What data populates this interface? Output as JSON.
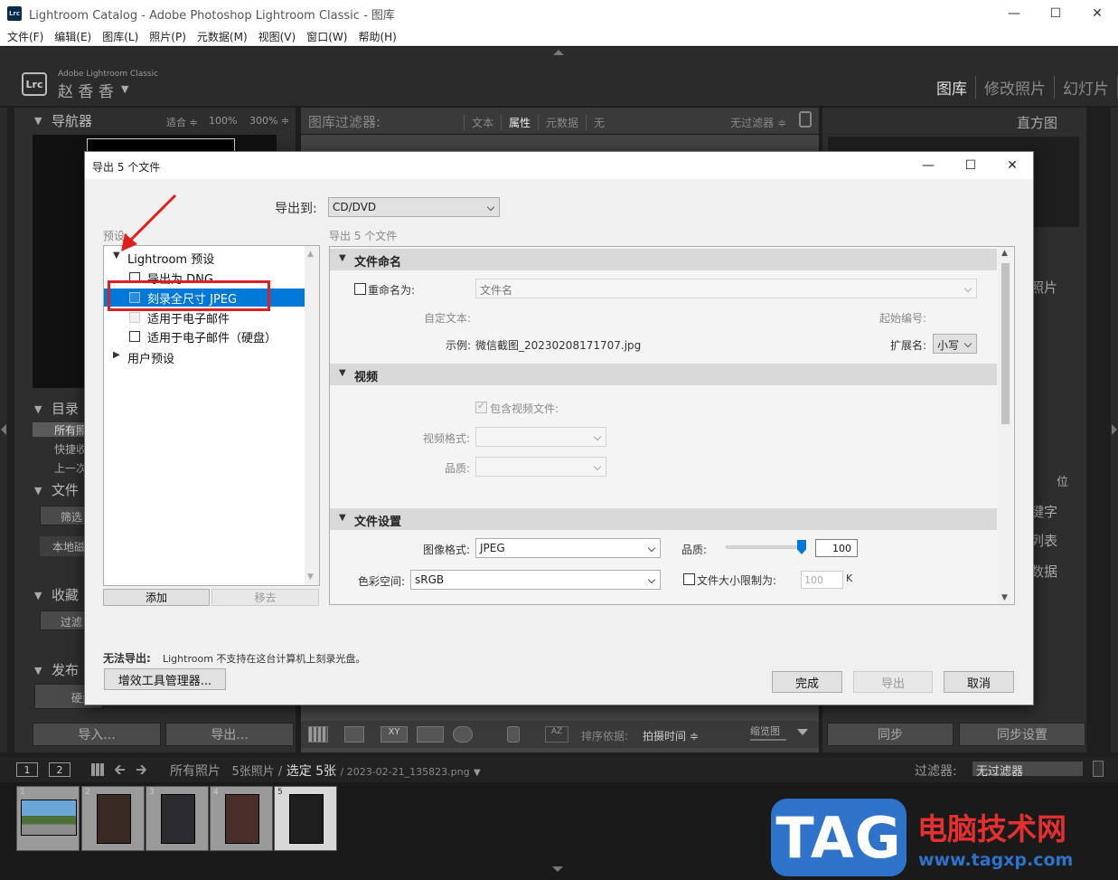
{
  "window": {
    "title": "Lightroom Catalog - Adobe Photoshop Lightroom Classic - 图库",
    "icon_text": "Lrc"
  },
  "menu": [
    "文件(F)",
    "编辑(E)",
    "图库(L)",
    "照片(P)",
    "元数据(M)",
    "视图(V)",
    "窗口(W)",
    "帮助(H)"
  ],
  "identity": {
    "badge": "Lrc",
    "brand": "Adobe Lightroom Classic",
    "user": "赵 香 香"
  },
  "modules": [
    "图库",
    "修改照片",
    "幻灯片"
  ],
  "navigator": {
    "title": "导航器",
    "zooms": [
      "适合 ≑",
      "100%",
      "300% ≑"
    ]
  },
  "left_panels": {
    "catalog": "目录",
    "catalog_items": [
      "所有照",
      "快捷收",
      "上一次"
    ],
    "folders": "文件",
    "folders_filter": "筛选",
    "local_disk": "本地磁",
    "collections": "收藏",
    "collections_filter": "过滤",
    "publish": "发布",
    "hard_drive": "硬盘"
  },
  "library_filter": {
    "label": "图库过滤器:",
    "tabs": [
      "文本",
      "属性",
      "元数据",
      "无"
    ],
    "active_tab": "属性",
    "no_filter": "无过滤器 ≑"
  },
  "right_panels": {
    "histogram": "直方图",
    "quick_develop": "照片",
    "keywording": "键字",
    "keyword_list": "列表",
    "metadata": "数据",
    "position": "位"
  },
  "bottom_buttons": {
    "import": "导入...",
    "export": "导出...",
    "sync": "同步",
    "sync_settings": "同步设置"
  },
  "toolbar": {
    "sort_label": "排序依据:",
    "sort_value": "拍摄时间 ≑",
    "thumb_label": "缩览图"
  },
  "filmstrip_bar": {
    "page1": "1",
    "page2": "2",
    "source": "所有照片",
    "count": "5张照片 /",
    "selected": "选定 5张",
    "filename": "/ 2023-02-21_135823.png",
    "filter_label": "过滤器:",
    "filter_value": "无过滤器"
  },
  "filmstrip": [
    {
      "n": "1"
    },
    {
      "n": "2"
    },
    {
      "n": "3"
    },
    {
      "n": "4"
    },
    {
      "n": "5"
    }
  ],
  "dialog": {
    "title": "导出 5 个文件",
    "export_to_label": "导出到:",
    "export_to_value": "CD/DVD",
    "presets_label": "预设:",
    "subheader": "导出 5 个文件",
    "presets": [
      {
        "label": "Lightroom 预设",
        "kind": "group"
      },
      {
        "label": "导出为 DNG",
        "kind": "item"
      },
      {
        "label": "刻录全尺寸 JPEG",
        "kind": "item",
        "selected": true
      },
      {
        "label": "适用于电子邮件",
        "kind": "item"
      },
      {
        "label": "适用于电子邮件（硬盘）",
        "kind": "item"
      },
      {
        "label": "用户预设",
        "kind": "group-collapsed"
      }
    ],
    "add_button": "添加",
    "remove_button": "移去",
    "file_naming": {
      "header": "文件命名",
      "rename_label": "重命名为:",
      "rename_value": "文件名",
      "custom_text": "自定文本:",
      "start_number": "起始编号:",
      "example_label": "示例:",
      "example_value": "微信截图_20230208171707.jpg",
      "extension_label": "扩展名:",
      "extension_value": "小写"
    },
    "video": {
      "header": "视频",
      "include_label": "包含视频文件:",
      "format_label": "视频格式:",
      "quality_label": "品质:"
    },
    "file_settings": {
      "header": "文件设置",
      "format_label": "图像格式:",
      "format_value": "JPEG",
      "quality_label": "品质:",
      "quality_value": "100",
      "quality_level": 1.0,
      "colorspace_label": "色彩空间:",
      "colorspace_value": "sRGB",
      "limit_label": "文件大小限制为:",
      "limit_value": "100",
      "limit_unit": "K"
    },
    "warning_label": "无法导出:",
    "warning_text": "Lightroom 不支持在这台计算机上刻录光盘。",
    "plugin_button": "增效工具管理器...",
    "done_button": "完成",
    "export_button": "导出",
    "cancel_button": "取消"
  },
  "watermark": {
    "logo": "TAG",
    "site_name": "电脑技术网",
    "url": "www.tagxp.com"
  }
}
